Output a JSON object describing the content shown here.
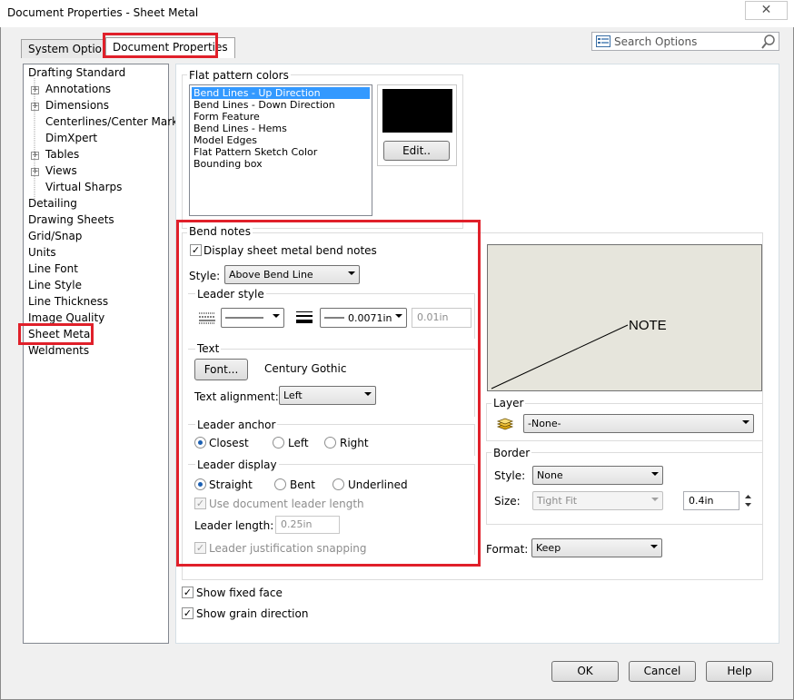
{
  "window": {
    "title": "Document Properties - Sheet Metal",
    "close_glyph": "✕"
  },
  "tabs": [
    {
      "label": "System Options"
    },
    {
      "label": "Document Properties"
    }
  ],
  "search": {
    "placeholder": "Search Options"
  },
  "tree": {
    "items": [
      {
        "label": "Drafting Standard"
      },
      {
        "label": "Annotations"
      },
      {
        "label": "Dimensions"
      },
      {
        "label": "Centerlines/Center Marks"
      },
      {
        "label": "DimXpert"
      },
      {
        "label": "Tables"
      },
      {
        "label": "Views"
      },
      {
        "label": "Virtual Sharps"
      },
      {
        "label": "Detailing"
      },
      {
        "label": "Drawing Sheets"
      },
      {
        "label": "Grid/Snap"
      },
      {
        "label": "Units"
      },
      {
        "label": "Line Font"
      },
      {
        "label": "Line Style"
      },
      {
        "label": "Line Thickness"
      },
      {
        "label": "Image Quality"
      },
      {
        "label": "Sheet Metal"
      },
      {
        "label": "Weldments"
      }
    ],
    "selected": "Sheet Metal"
  },
  "flat_pattern": {
    "title": "Flat pattern colors",
    "items": [
      {
        "label": "Bend Lines - Up Direction"
      },
      {
        "label": "Bend Lines - Down Direction"
      },
      {
        "label": "Form Feature"
      },
      {
        "label": "Bend Lines - Hems"
      },
      {
        "label": "Model Edges"
      },
      {
        "label": "Flat Pattern Sketch Color"
      },
      {
        "label": "Bounding box"
      }
    ],
    "selected": "Bend Lines - Up Direction",
    "swatch_color": "#000000",
    "edit_label": "Edit.."
  },
  "bend_notes": {
    "title": "Bend notes",
    "display_label": "Display sheet metal bend notes",
    "display_checked": true,
    "style_label": "Style:",
    "style_value": "Above Bend Line",
    "leader_style": {
      "title": "Leader style",
      "thickness_value": "0.0071in",
      "custom_value": "0.01in"
    },
    "text": {
      "title": "Text",
      "font_button": "Font...",
      "font_name": "Century Gothic",
      "alignment_label": "Text alignment:",
      "alignment_value": "Left"
    },
    "leader_anchor": {
      "title": "Leader anchor",
      "options": [
        "Closest",
        "Left",
        "Right"
      ],
      "selected": "Closest"
    },
    "leader_display": {
      "title": "Leader display",
      "options": [
        "Straight",
        "Bent",
        "Underlined"
      ],
      "selected": "Straight",
      "use_doc_length_label": "Use document leader length",
      "leader_length_label": "Leader length:",
      "leader_length_value": "0.25in",
      "justification_label": "Leader justification snapping"
    }
  },
  "preview": {
    "note_text": "NOTE",
    "background": "#e6e5dc"
  },
  "layer": {
    "title": "Layer",
    "value": "-None-"
  },
  "border": {
    "title": "Border",
    "style_label": "Style:",
    "style_value": "None",
    "size_label": "Size:",
    "size_value": "Tight Fit",
    "size_spin_value": "0.4in"
  },
  "format": {
    "label": "Format:",
    "value": "Keep"
  },
  "options": {
    "show_fixed_face": "Show fixed face",
    "show_grain_direction": "Show grain direction",
    "fixed_face_checked": true,
    "grain_checked": true
  },
  "footer": {
    "ok": "OK",
    "cancel": "Cancel",
    "help": "Help"
  },
  "highlight_color": "#e0202a"
}
